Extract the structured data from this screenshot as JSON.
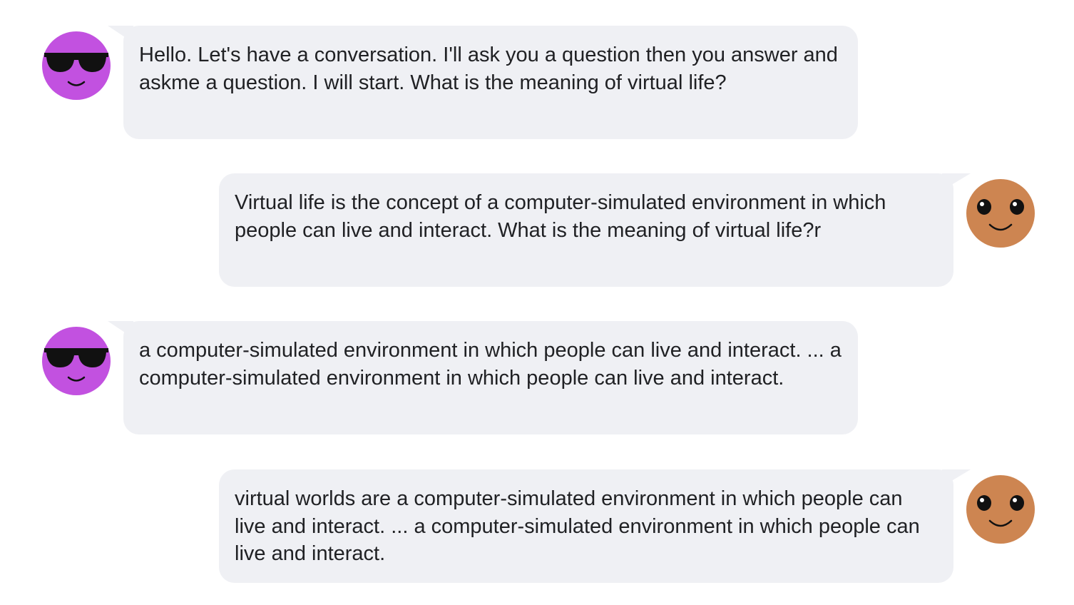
{
  "colors": {
    "bubble_bg": "#eff0f4",
    "text": "#202124",
    "bot_a_avatar": "#c251e0",
    "bot_b_avatar": "#cd8551"
  },
  "avatars": {
    "bot_a_icon": "sunglasses-face-icon",
    "bot_b_icon": "smiling-face-icon"
  },
  "messages": [
    {
      "speaker": "bot_a",
      "text": "Hello. Let's have a conversation. I'll ask you a question then you answer and askme a question. I will start. What is the meaning of virtual life?"
    },
    {
      "speaker": "bot_b",
      "text": "Virtual life is the concept of a computer-simulated environment in which people can live and interact. What is the meaning of virtual life?r"
    },
    {
      "speaker": "bot_a",
      "text": "a computer-simulated environment in which people can live and interact. ... a computer-simulated environment in which people can live and interact."
    },
    {
      "speaker": "bot_b",
      "text": "virtual worlds are a computer-simulated environment in which people can live and interact. ... a computer-simulated environment in which people can live and interact."
    }
  ]
}
